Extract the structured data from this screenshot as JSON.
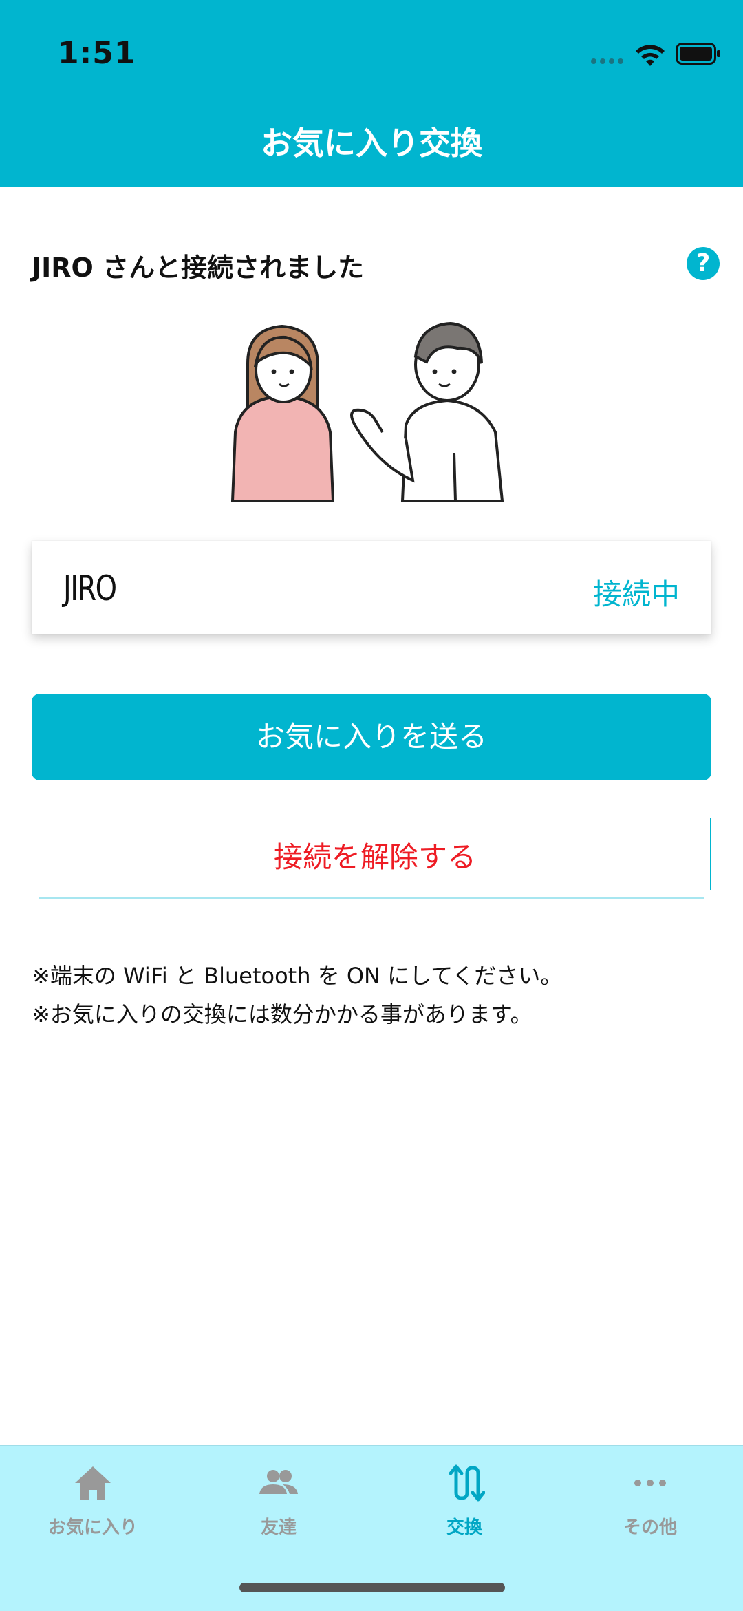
{
  "status_bar": {
    "time": "1:51"
  },
  "header": {
    "title": "お気に入り交換"
  },
  "content": {
    "connected_heading": "JIRO さんと接続されました",
    "help_label": "?",
    "connection": {
      "device_name": "JIRO",
      "status": "接続中"
    },
    "send_button_label": "お気に入りを送る",
    "disconnect_button_label": "接続を解除する",
    "notes": [
      "※端末の WiFi と Bluetooth を ON にしてください。",
      "※お気に入りの交換には数分かかる事があります。"
    ]
  },
  "tab_bar": {
    "tabs": [
      {
        "label": "お気に入り",
        "icon": "home-icon",
        "active": false
      },
      {
        "label": "友達",
        "icon": "people-icon",
        "active": false
      },
      {
        "label": "交換",
        "icon": "exchange-icon",
        "active": true
      },
      {
        "label": "その他",
        "icon": "more-icon",
        "active": false
      }
    ]
  },
  "colors": {
    "accent": "#01b5cf",
    "danger": "#ee1c24",
    "tab_bar_bg": "#b4f3fd",
    "inactive_tab": "#999999",
    "active_tab": "#01a6c4"
  }
}
